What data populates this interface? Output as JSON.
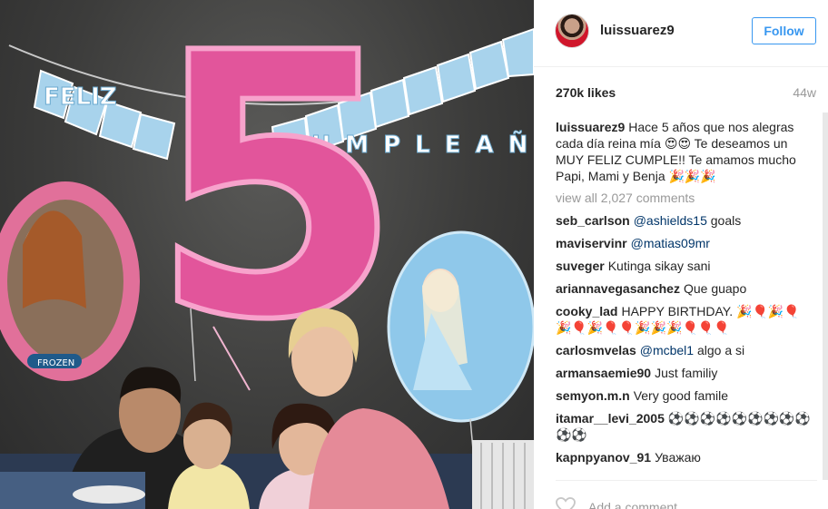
{
  "post": {
    "username": "luissuarez9",
    "follow_label": "Follow",
    "likes": "270k likes",
    "time_ago": "44w",
    "caption": "Hace 5 años que nos alegras cada día reina mía 😍😍 Te deseamos un MUY FELIZ CUMPLE!! Te amamos mucho Papi, Mami y Benja 🎉🎉🎉",
    "view_all": "view all 2,027 comments",
    "add_comment_placeholder": "Add a comment..."
  },
  "photo": {
    "banner_left": "FELIZ",
    "banner_right": "CUMPLEAÑ",
    "balloon_number": "5",
    "badge": "FROZEN"
  },
  "comments": [
    {
      "user": "seb_carlson",
      "mention": "@ashields15",
      "text": "goals"
    },
    {
      "user": "maviservinr",
      "mention": "@matias09mr",
      "text": ""
    },
    {
      "user": "suveger",
      "mention": "",
      "text": "Kutinga sikay sani"
    },
    {
      "user": "ariannavegasanchez",
      "mention": "",
      "text": "Que guapo"
    },
    {
      "user": "cooky_lad",
      "mention": "",
      "text": "HAPPY BIRTHDAY. 🎉🎈🎉🎈🎉🎈🎉🎈🎈🎉🎉🎉🎈🎈🎈"
    },
    {
      "user": "carlosmvelas",
      "mention": "@mcbel1",
      "text": "algo a si"
    },
    {
      "user": "armansaemie90",
      "mention": "",
      "text": "Just familiy"
    },
    {
      "user": "semyon.m.n",
      "mention": "",
      "text": "Very good famile"
    },
    {
      "user": "itamar__levi_2005",
      "mention": "",
      "text": "⚽⚽⚽⚽⚽⚽⚽⚽⚽⚽⚽"
    },
    {
      "user": "kapnpyanov_91",
      "mention": "",
      "text": "Уважаю"
    }
  ]
}
